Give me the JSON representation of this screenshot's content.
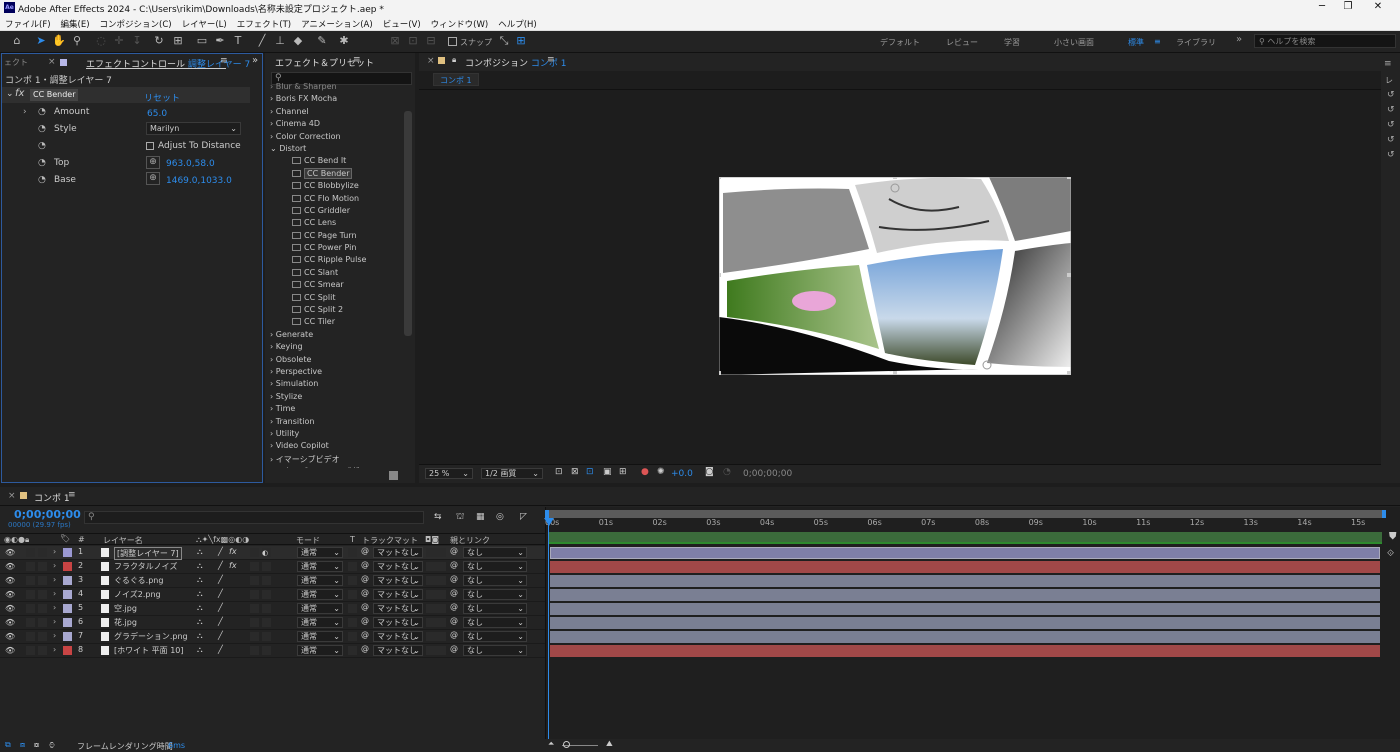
{
  "window": {
    "app_label": "Ae",
    "title": "Adobe After Effects 2024 - C:\\Users\\rikim\\Downloads\\名称未設定プロジェクト.aep *",
    "min": "─",
    "max": "❐",
    "close": "✕"
  },
  "menu": [
    "ファイル(F)",
    "編集(E)",
    "コンポジション(C)",
    "レイヤー(L)",
    "エフェクト(T)",
    "アニメーション(A)",
    "ビュー(V)",
    "ウィンドウ(W)",
    "ヘルプ(H)"
  ],
  "toolbar": {
    "snap_label": "スナップ",
    "workspaces": [
      "デフォルト",
      "レビュー",
      "学習",
      "小さい画面",
      "標準",
      "ライブラリ"
    ],
    "current_workspace": "標準",
    "more": "»",
    "help_placeholder": "ヘルプを検索"
  },
  "effect_controls": {
    "left_tab": "ェクト",
    "tab_prefix": "エフェクトコントロール",
    "tab_layer": "調整レイヤー 7",
    "breadcrumb": "コンポ 1・調整レイヤー 7",
    "effect_name": "CC Bender",
    "reset": "リセット",
    "props": [
      {
        "name": "Amount",
        "value": "65.0"
      },
      {
        "name": "Style",
        "value": "Marilyn"
      },
      {
        "name": "",
        "value": "Adjust To Distance"
      },
      {
        "name": "Top",
        "value": "963.0,58.0"
      },
      {
        "name": "Base",
        "value": "1469.0,1033.0"
      }
    ]
  },
  "effects_presets": {
    "title": "エフェクト＆プリセット",
    "search_placeholder": "",
    "cut_item": "Blur & Sharpen",
    "categories_before": [
      "Boris FX Mocha",
      "Channel",
      "Cinema 4D",
      "Color Correction"
    ],
    "open_category": "Distort",
    "distort_items": [
      "CC Bend It",
      "CC Bender",
      "CC Blobbylize",
      "CC Flo Motion",
      "CC Griddler",
      "CC Lens",
      "CC Page Turn",
      "CC Power Pin",
      "CC Ripple Pulse",
      "CC Slant",
      "CC Smear",
      "CC Split",
      "CC Split 2",
      "CC Tiler"
    ],
    "selected_item": "CC Bender",
    "categories_after": [
      "Generate",
      "Keying",
      "Obsolete",
      "Perspective",
      "Simulation",
      "Stylize",
      "Time",
      "Transition",
      "Utility",
      "Video Copilot",
      "イマーシブビデオ",
      "エクスプレッション制御"
    ]
  },
  "composition": {
    "tab_label": "コンポジション",
    "comp_name": "コンポ 1",
    "sub_tab": "コンポ 1",
    "zoom": "25 %",
    "resolution": "1/2 画質",
    "exposure": "+0.0",
    "timecode": "0;00;00;00"
  },
  "timeline": {
    "tab": "コンポ 1",
    "timecode": "0;00;00;00",
    "fps_info": "00000 (29.97 fps)",
    "search_placeholder": "",
    "headers": {
      "num": "#",
      "layer_name": "レイヤー名",
      "mode": "モード",
      "t": "T",
      "trackmatte": "トラックマット",
      "parent": "親とリンク"
    },
    "ruler": [
      "00s",
      "01s",
      "02s",
      "03s",
      "04s",
      "05s",
      "06s",
      "07s",
      "08s",
      "09s",
      "10s",
      "11s",
      "12s",
      "13s",
      "14s",
      "15s"
    ],
    "layers": [
      {
        "num": "1",
        "name": "[調整レイヤー 7]",
        "label_color": "#9a98d2",
        "mode": "通常",
        "matte": "マットなし",
        "parent": "なし",
        "bar_color": "#7f7fa8",
        "fx": "fx"
      },
      {
        "num": "2",
        "name": "フラクタルノイズ",
        "label_color": "#c84444",
        "mode": "通常",
        "matte": "マットなし",
        "parent": "なし",
        "bar_color": "#a14848",
        "fx": "fx"
      },
      {
        "num": "3",
        "name": "ぐるぐる.png",
        "label_color": "#a8a8d0",
        "mode": "通常",
        "matte": "マットなし",
        "parent": "なし",
        "bar_color": "#7a7f93",
        "fx": ""
      },
      {
        "num": "4",
        "name": "ノイズ2.png",
        "label_color": "#a8a8d0",
        "mode": "通常",
        "matte": "マットなし",
        "parent": "なし",
        "bar_color": "#7a7f93",
        "fx": ""
      },
      {
        "num": "5",
        "name": "空.jpg",
        "label_color": "#a8a8d0",
        "mode": "通常",
        "matte": "マットなし",
        "parent": "なし",
        "bar_color": "#7a7f93",
        "fx": ""
      },
      {
        "num": "6",
        "name": "花.jpg",
        "label_color": "#a8a8d0",
        "mode": "通常",
        "matte": "マットなし",
        "parent": "なし",
        "bar_color": "#7a7f93",
        "fx": ""
      },
      {
        "num": "7",
        "name": "グラデーション.png",
        "label_color": "#a8a8d0",
        "mode": "通常",
        "matte": "マットなし",
        "parent": "なし",
        "bar_color": "#7a7f93",
        "fx": ""
      },
      {
        "num": "8",
        "name": "[ホワイト 平面 10]",
        "label_color": "#c84444",
        "mode": "通常",
        "matte": "マットなし",
        "parent": "なし",
        "bar_color": "#a14848",
        "fx": ""
      }
    ]
  },
  "status": {
    "label": "フレームレンダリング時間",
    "value": "6ms"
  },
  "colors": {
    "accent": "#2d8ceb",
    "panel": "#232323",
    "bg": "#1d1d1d"
  }
}
